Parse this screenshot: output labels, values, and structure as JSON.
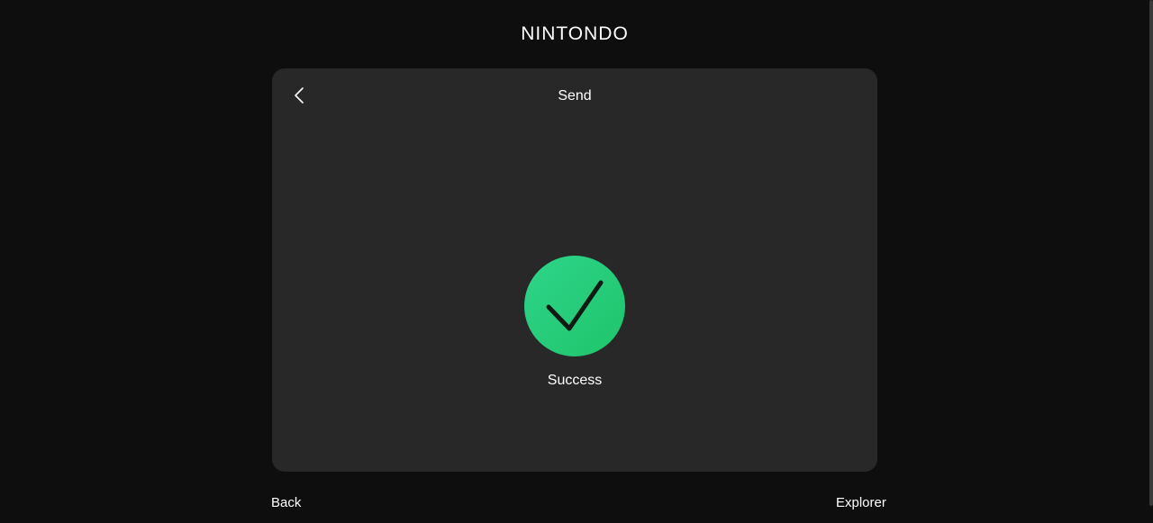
{
  "header": {
    "brand": "NINTONDO"
  },
  "card": {
    "title": "Send",
    "back_icon": "chevron-left-icon",
    "status_icon": "checkmark-icon",
    "status_color": "#26cc7a",
    "status_label": "Success"
  },
  "footer": {
    "back_label": "Back",
    "explorer_label": "Explorer"
  }
}
